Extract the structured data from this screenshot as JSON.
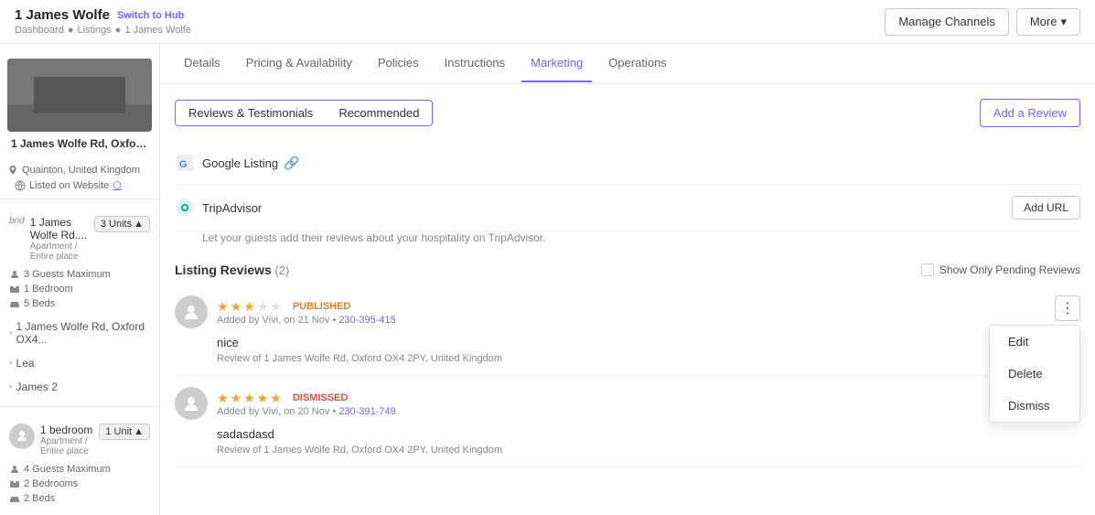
{
  "header": {
    "title": "1 James Wolfe",
    "switch_to_hub": "Switch to Hub",
    "breadcrumbs": [
      "Dashboard",
      "Listings",
      "1 James Wolfe"
    ],
    "manage_channels_btn": "Manage Channels",
    "more_btn": "More"
  },
  "sidebar": {
    "listing_name": "1 James Wolfe Rd, Oxford O...",
    "listing_location": "Quainton, United Kingdom",
    "listing_website": "Listed on Website",
    "units": [
      {
        "name": "1 James Wolfe Rd....",
        "type": "Apartment / Entire place",
        "guests": "3 Guests Maximum",
        "bedrooms": "1 Bedroom",
        "beds": "5 Beds",
        "count": "3 Units"
      }
    ],
    "sub_items": [
      {
        "label": "1 James Wolfe Rd, Oxford OX4..."
      },
      {
        "label": "Lea"
      },
      {
        "label": "James 2"
      }
    ],
    "second_listing": {
      "name": "1 bedroom",
      "type": "Apartment / Entire place",
      "guests": "4 Guests Maximum",
      "bedrooms": "2 Bedrooms",
      "beds": "2 Beds",
      "count": "1 Unit"
    }
  },
  "tabs": [
    {
      "label": "Details"
    },
    {
      "label": "Pricing & Availability"
    },
    {
      "label": "Policies"
    },
    {
      "label": "Instructions"
    },
    {
      "label": "Marketing",
      "active": true
    },
    {
      "label": "Operations"
    }
  ],
  "marketing": {
    "section_tabs": [
      {
        "label": "Reviews & Testimonials",
        "active": true
      },
      {
        "label": "Recommended",
        "badge": true
      }
    ],
    "add_review_btn": "Add a Review",
    "google_listing": {
      "label": "Google Listing"
    },
    "tripadvisor": {
      "label": "TripAdvisor",
      "description": "Let your guests add their reviews about your hospitality on TripAdvisor.",
      "add_url_btn": "Add URL"
    },
    "listing_reviews": {
      "title": "Listing Reviews",
      "count": "(2)",
      "show_pending_label": "Show Only Pending Reviews"
    },
    "reviews": [
      {
        "stars": 3,
        "max_stars": 5,
        "status": "PUBLISHED",
        "status_class": "published",
        "added_by": "Vivi",
        "added_date": "21 Nov",
        "ref": "230-395-415",
        "text": "nice",
        "property": "Review of 1 James Wolfe Rd, Oxford OX4 2PY, United Kingdom",
        "has_dropdown": true
      },
      {
        "stars": 5,
        "max_stars": 5,
        "status": "DISMISSED",
        "status_class": "dismissed",
        "added_by": "Vivi",
        "added_date": "20 Nov",
        "ref": "230-391-749",
        "text": "sadasdasd",
        "property": "Review of 1 James Wolfe Rd, Oxford OX4 2PY, United Kingdom",
        "has_dropdown": false
      }
    ],
    "dropdown_menu": {
      "edit": "Edit",
      "delete": "Delete",
      "dismiss": "Dismiss"
    }
  }
}
